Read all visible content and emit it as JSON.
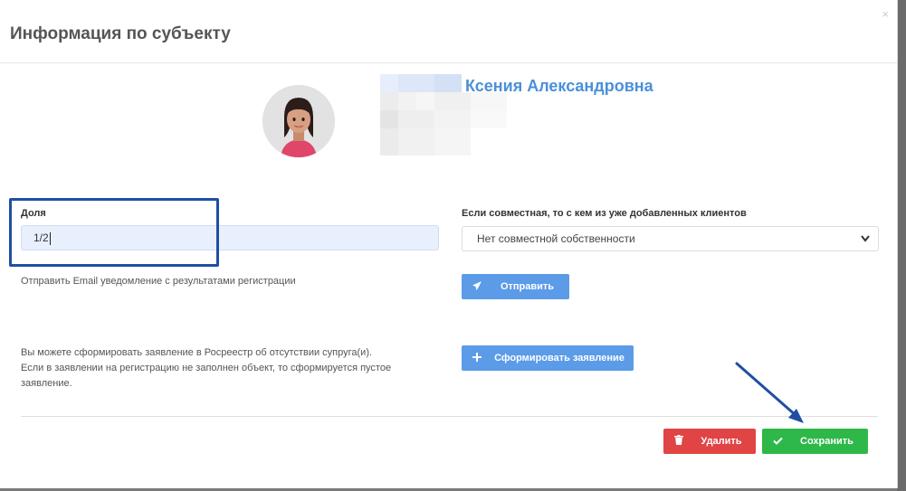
{
  "modal": {
    "title": "Информация по субъекту",
    "close_label": "×"
  },
  "subject": {
    "name": "Ксения Александровна"
  },
  "share": {
    "label": "Доля",
    "value": "1/2"
  },
  "joint": {
    "label": "Если совместная, то с кем из уже добавленных клиентов",
    "selected": "Нет совместной собственности"
  },
  "email": {
    "text": "Отправить Email уведомление с результатами регистрации",
    "button_label": "Отправить"
  },
  "statement": {
    "line1": "Вы можете сформировать заявление в Росреестр об отсутствии супруга(и).",
    "line2": "Если в заявлении на регистрацию не заполнен объект, то сформируется пустое",
    "line3": "заявление.",
    "button_label": "Сформировать заявление"
  },
  "footer": {
    "delete_label": "Удалить",
    "save_label": "Сохранить"
  },
  "colors": {
    "accent": "#5b9be8",
    "danger": "#e04444",
    "success": "#2fb84a",
    "highlight": "#1e4fa3"
  },
  "icons": {
    "send": "paper-plane-icon",
    "plus": "plus-icon",
    "delete": "trash-icon",
    "save": "check-icon",
    "dropdown": "chevron-down-icon",
    "close": "close-icon"
  }
}
